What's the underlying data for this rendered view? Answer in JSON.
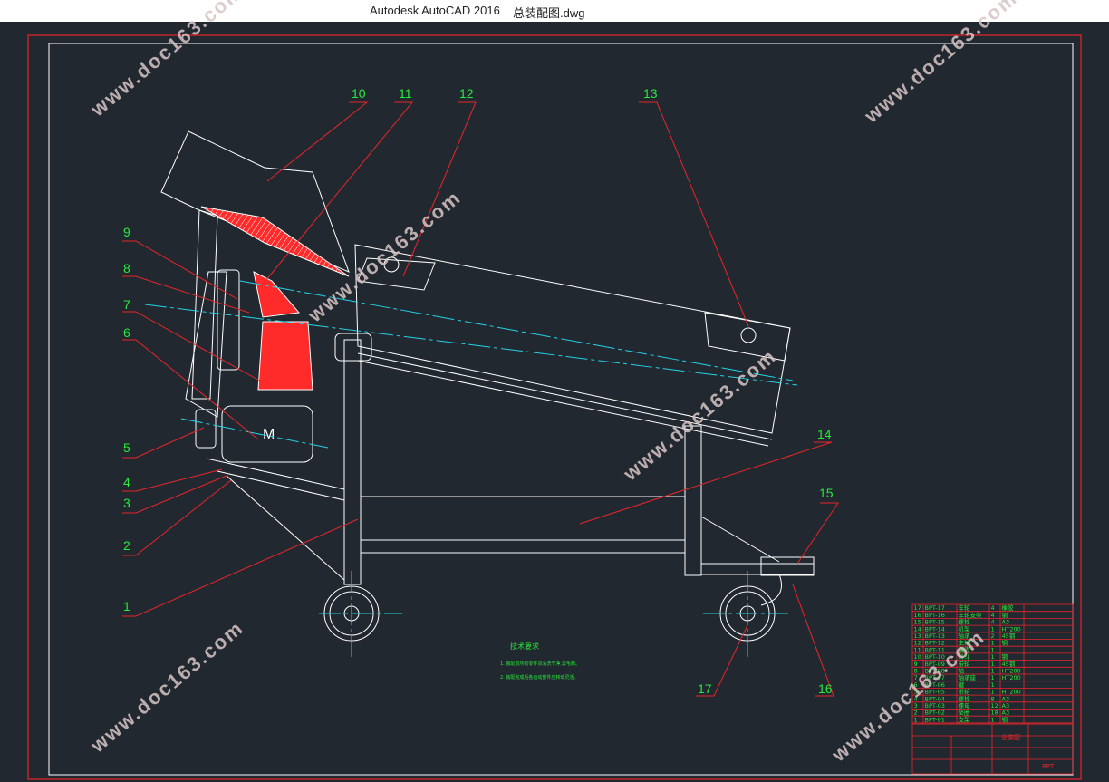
{
  "window": {
    "app_title": "Autodesk AutoCAD 2016",
    "file_name": "总装配图.dwg"
  },
  "colors": {
    "background": "#212830",
    "frame": "#e8262a",
    "lines": "#ffffff",
    "leaders": "#e8262a",
    "labels": "#28e83a",
    "section": "#ff2a2a",
    "centerline": "#24d2e6",
    "notes": "#28e83a"
  },
  "balloons": [
    "1",
    "2",
    "3",
    "4",
    "5",
    "6",
    "7",
    "8",
    "9",
    "10",
    "11",
    "12",
    "13",
    "14",
    "15",
    "16",
    "17"
  ],
  "motor_label": "M",
  "tech_notes": {
    "title": "技术要求",
    "line1": "1. 装配前所有零件须清洗干净,去毛刺。",
    "line2": "2. 装配完成后各运动部件应转动灵活。"
  },
  "bom_rows": [
    [
      "17",
      "BPT-17",
      "车轮",
      "4",
      "橡胶"
    ],
    [
      "16",
      "BPT-16",
      "车轮支架",
      "4",
      "钢"
    ],
    [
      "15",
      "BPT-15",
      "螺栓",
      "4",
      "A3"
    ],
    [
      "14",
      "BPT-14",
      "机架",
      "1",
      "HT200"
    ],
    [
      "13",
      "BPT-13",
      "轴承",
      "2",
      "45钢"
    ],
    [
      "12",
      "BPT-12",
      "主轴",
      "1",
      "钢"
    ],
    [
      "11",
      "BPT-11",
      "罩壳",
      "1",
      ""
    ],
    [
      "10",
      "BPT-10",
      "料斗",
      "1",
      "钢"
    ],
    [
      "9",
      "BPT-09",
      "带轮",
      "1",
      "45钢"
    ],
    [
      "8",
      "BPT-08",
      "轴",
      "1",
      "HT200"
    ],
    [
      "7",
      "BPT-07",
      "轴承座",
      "1",
      "HT200"
    ],
    [
      "6",
      "BPT-06",
      "键",
      "1",
      ""
    ],
    [
      "5",
      "BPT-05",
      "带轮",
      "1",
      "HT200"
    ],
    [
      "4",
      "BPT-04",
      "螺栓",
      "8",
      "A3"
    ],
    [
      "3",
      "BPT-03",
      "螺母",
      "12",
      "A3"
    ],
    [
      "2",
      "BPT-02",
      "垫圈",
      "18",
      "A3"
    ],
    [
      "1",
      "BPT-01",
      "支架",
      "1",
      "钢"
    ]
  ],
  "title_block": {
    "drawing_name": "总装配",
    "drawing_code": "BPT"
  },
  "watermark": "www.doc163.com"
}
